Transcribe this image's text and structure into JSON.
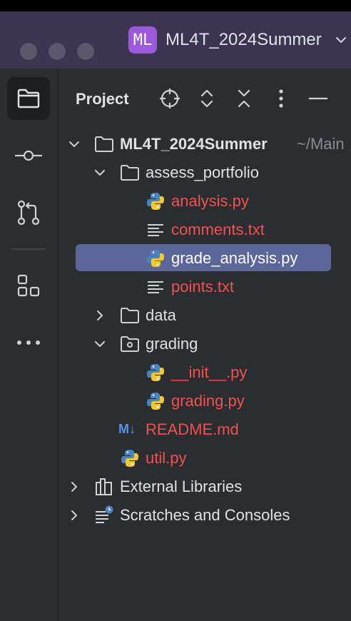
{
  "window": {
    "project_badge": "ML",
    "project_name": "ML4T_2024Summer"
  },
  "left_toolbar": {
    "items": [
      {
        "icon": "folder-icon",
        "active": true
      },
      {
        "icon": "commit-icon",
        "active": false
      },
      {
        "icon": "pull-request-icon",
        "active": false
      },
      {
        "icon": "structure-icon",
        "active": false
      },
      {
        "icon": "more-icon",
        "active": false
      }
    ]
  },
  "panel": {
    "title": "Project",
    "header_icons": [
      "locate-icon",
      "expand-all-icon",
      "collapse-all-icon",
      "options-icon",
      "hide-icon"
    ]
  },
  "tree": {
    "root": {
      "label": "ML4T_2024Summer",
      "path_hint": "~/Main"
    },
    "assess_portfolio": {
      "label": "assess_portfolio"
    },
    "analysis": {
      "label": "analysis.py"
    },
    "comments": {
      "label": "comments.txt"
    },
    "grade_analysis": {
      "label": "grade_analysis.py"
    },
    "points": {
      "label": "points.txt"
    },
    "data": {
      "label": "data"
    },
    "grading_folder": {
      "label": "grading"
    },
    "init": {
      "label": "__init__.py"
    },
    "grading_py": {
      "label": "grading.py"
    },
    "readme": {
      "label": "README.md",
      "badge": "M↓"
    },
    "util": {
      "label": "util.py"
    },
    "external": {
      "label": "External Libraries"
    },
    "scratches": {
      "label": "Scratches and Consoles"
    }
  },
  "colors": {
    "titlebar": "#3c3552",
    "panel": "#2b2d30",
    "selection": "#5c6699",
    "modified_file": "#f0524f",
    "badge": "#9b59d9"
  }
}
